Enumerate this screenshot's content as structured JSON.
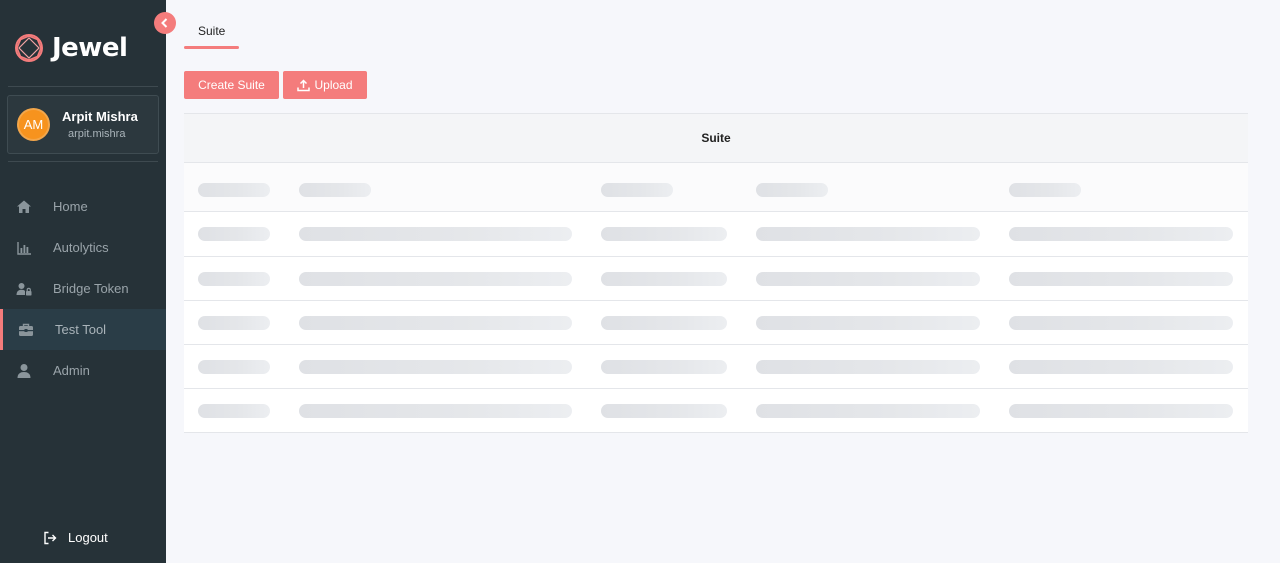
{
  "app": {
    "title": "Jewel"
  },
  "colors": {
    "accent": "#f47c7c",
    "sidebar_bg": "#263238",
    "avatar_bg": "#f7931e"
  },
  "user": {
    "initials": "AM",
    "name": "Arpit Mishra",
    "handle": "arpit.mishra"
  },
  "nav": {
    "items": [
      {
        "label": "Home",
        "icon": "home-icon"
      },
      {
        "label": "Autolytics",
        "icon": "bar-chart-icon"
      },
      {
        "label": "Bridge Token",
        "icon": "user-lock-icon"
      },
      {
        "label": "Test Tool",
        "icon": "toolbox-icon",
        "active": true
      },
      {
        "label": "Admin",
        "icon": "user-icon"
      }
    ],
    "logout_label": "Logout"
  },
  "tabs": [
    {
      "label": "Suite",
      "active": true
    }
  ],
  "toolbar": {
    "create_label": "Create Suite",
    "upload_label": "Upload"
  },
  "table": {
    "header": "Suite",
    "loading": true,
    "skeleton_rows": 6
  }
}
